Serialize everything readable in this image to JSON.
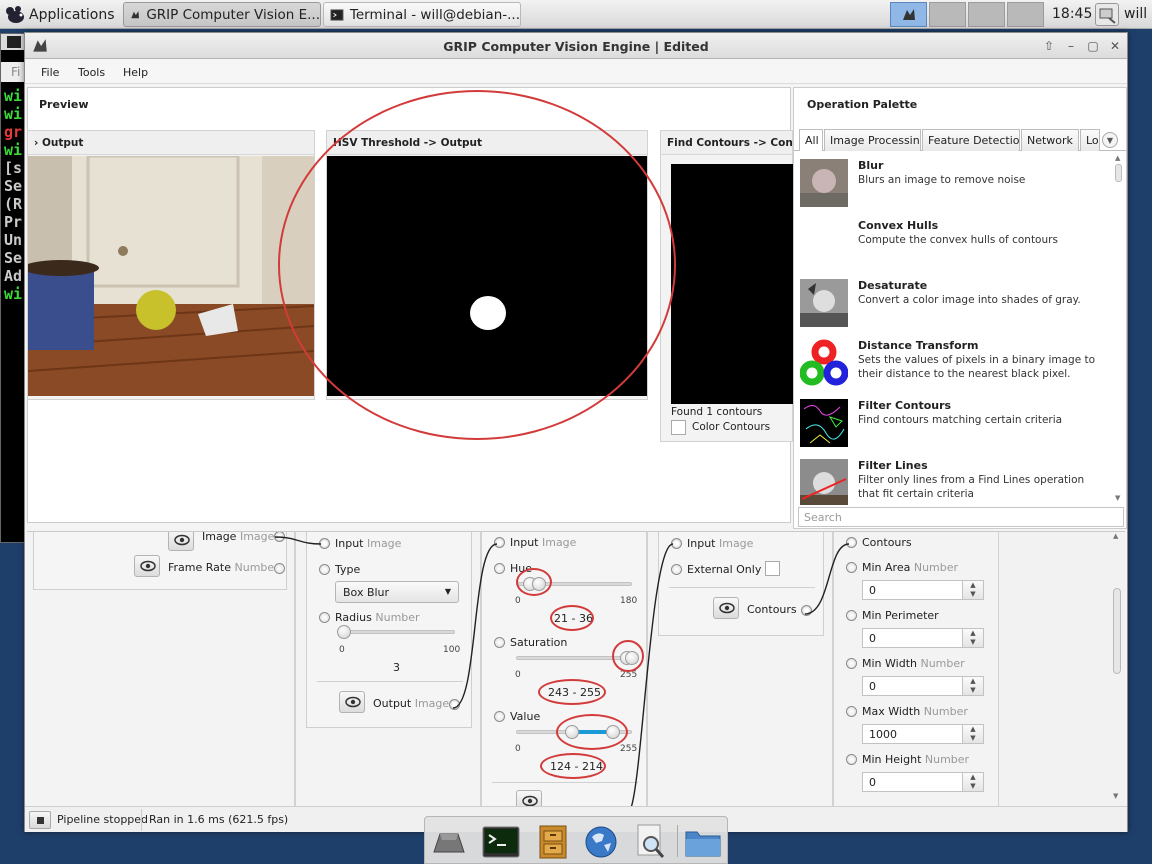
{
  "taskbar": {
    "apps_label": "Applications",
    "tasks": [
      {
        "label": "GRIP Computer Vision E..."
      },
      {
        "label": "Terminal - will@debian-..."
      }
    ],
    "clock": "18:45",
    "user": "will"
  },
  "terminal": {
    "lines": [
      "wi",
      "wi",
      "gr",
      "wi",
      "[s",
      "Se",
      "(R",
      "Pr",
      "Un",
      "Se",
      "Ad",
      "wi"
    ],
    "menu_fragment": "Fi"
  },
  "window": {
    "title": "GRIP Computer Vision Engine | Edited",
    "menu": [
      "File",
      "Tools",
      "Help"
    ]
  },
  "preview": {
    "title": "Preview",
    "cards": [
      {
        "header": "› Output"
      },
      {
        "header": "HSV Threshold -> Output"
      },
      {
        "header": "Find Contours -> Contours"
      }
    ],
    "found": "Found 1 contours",
    "color_contours": "Color Contours"
  },
  "palette": {
    "title": "Operation Palette",
    "tabs": [
      "All",
      "Image Processing",
      "Feature Detection",
      "Network",
      "Lo"
    ],
    "ops": [
      {
        "name": "Blur",
        "desc": "Blurs an image to remove noise"
      },
      {
        "name": "Convex Hulls",
        "desc": "Compute the convex hulls of contours"
      },
      {
        "name": "Desaturate",
        "desc": "Convert a color image into shades of gray."
      },
      {
        "name": "Distance Transform",
        "desc": "Sets the values of pixels in a binary image to their distance to the nearest black pixel."
      },
      {
        "name": "Filter Contours",
        "desc": "Find contours matching certain criteria"
      },
      {
        "name": "Filter Lines",
        "desc": "Filter only lines from a Find Lines operation that fit certain criteria"
      }
    ],
    "search_placeholder": "Search"
  },
  "pipeline": {
    "source": {
      "image": "Image",
      "image_type": "Image",
      "frame_rate": "Frame Rate",
      "frame_rate_type": "Number"
    },
    "blur": {
      "input": "Input",
      "input_type": "Image",
      "type_label": "Type",
      "type_value": "Box Blur",
      "radius": "Radius",
      "radius_type": "Number",
      "min": "0",
      "max": "100",
      "value": "3",
      "radius_level": 0.03,
      "output": "Output",
      "output_type": "Image"
    },
    "hsv": {
      "input": "Input",
      "input_type": "Image",
      "hue": "Hue",
      "hue_min": "0",
      "hue_max": "180",
      "hue_value": "21 - 36",
      "hue_low": 21,
      "hue_high": 36,
      "hue_range": 180,
      "sat": "Saturation",
      "sat_min": "0",
      "sat_max": "255",
      "sat_value": "243 - 255",
      "sat_low": 243,
      "sat_high": 255,
      "val": "Value",
      "val_min": "0",
      "val_max": "255",
      "val_value": "124 - 214",
      "val_low": 124,
      "val_high": 214,
      "range255": 255
    },
    "contours": {
      "input": "Input",
      "input_type": "Image",
      "external_only": "External Only",
      "output": "Contours"
    },
    "filter": {
      "contours": "Contours",
      "fields": [
        {
          "label": "Min Area",
          "type": "Number",
          "value": "0"
        },
        {
          "label": "Min Perimeter",
          "type": "",
          "value": "0"
        },
        {
          "label": "Min Width",
          "type": "Number",
          "value": "0"
        },
        {
          "label": "Max Width",
          "type": "Number",
          "value": "1000"
        },
        {
          "label": "Min Height",
          "type": "Number",
          "value": "0"
        }
      ]
    }
  },
  "status": {
    "state": "Pipeline stopped",
    "timing": "Ran in 1.6 ms (621.5 fps)"
  },
  "colors": {
    "accent": "#1a9ad6",
    "annotation": "#d33b3b",
    "terminal_green": "#3adc3a",
    "terminal_red": "#e23c3c"
  }
}
